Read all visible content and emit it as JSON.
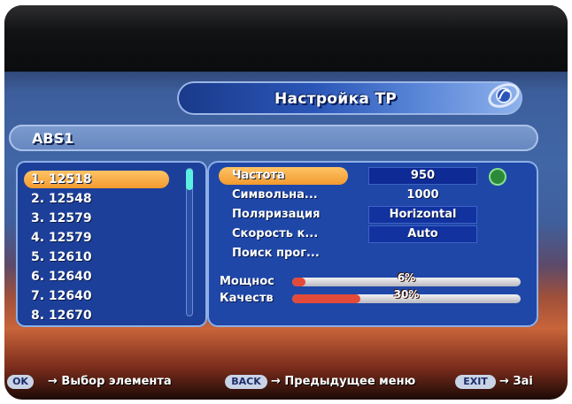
{
  "header": {
    "title": "Настройка ТР"
  },
  "satellite": {
    "name": "ABS1"
  },
  "tp_list": [
    {
      "label": "1. 12518",
      "selected": true
    },
    {
      "label": "2. 12548",
      "selected": false
    },
    {
      "label": "3. 12579",
      "selected": false
    },
    {
      "label": "4. 12579",
      "selected": false
    },
    {
      "label": "5. 12610",
      "selected": false
    },
    {
      "label": "6. 12640",
      "selected": false
    },
    {
      "label": "7. 12640",
      "selected": false
    },
    {
      "label": "8. 12670",
      "selected": false
    }
  ],
  "params": {
    "frequency": {
      "label": "Частота",
      "value": "950"
    },
    "symbol_rate": {
      "label": "Символьна...",
      "value": "1000"
    },
    "polarization": {
      "label": "Поляризация",
      "value": "Horizontal"
    },
    "speed": {
      "label": "Скорость к...",
      "value": "Auto"
    },
    "search": {
      "label": "Поиск прог..."
    }
  },
  "meters": {
    "power": {
      "label": "Мощнос",
      "text": "6%",
      "value": 0.06
    },
    "quality": {
      "label": "Качеств",
      "text": "30%",
      "value": 0.3
    }
  },
  "footer": {
    "ok_key": "OK",
    "ok_hint": "→ Выбор элемента",
    "back_key": "BACK",
    "back_hint": "→ Предыдущее меню",
    "exit_key": "EXIT",
    "exit_hint": "→ Заі"
  },
  "colors": {
    "highlight": "#f29a2e",
    "panel": "#1f47a8",
    "meter_fill": "#e24a3a"
  }
}
